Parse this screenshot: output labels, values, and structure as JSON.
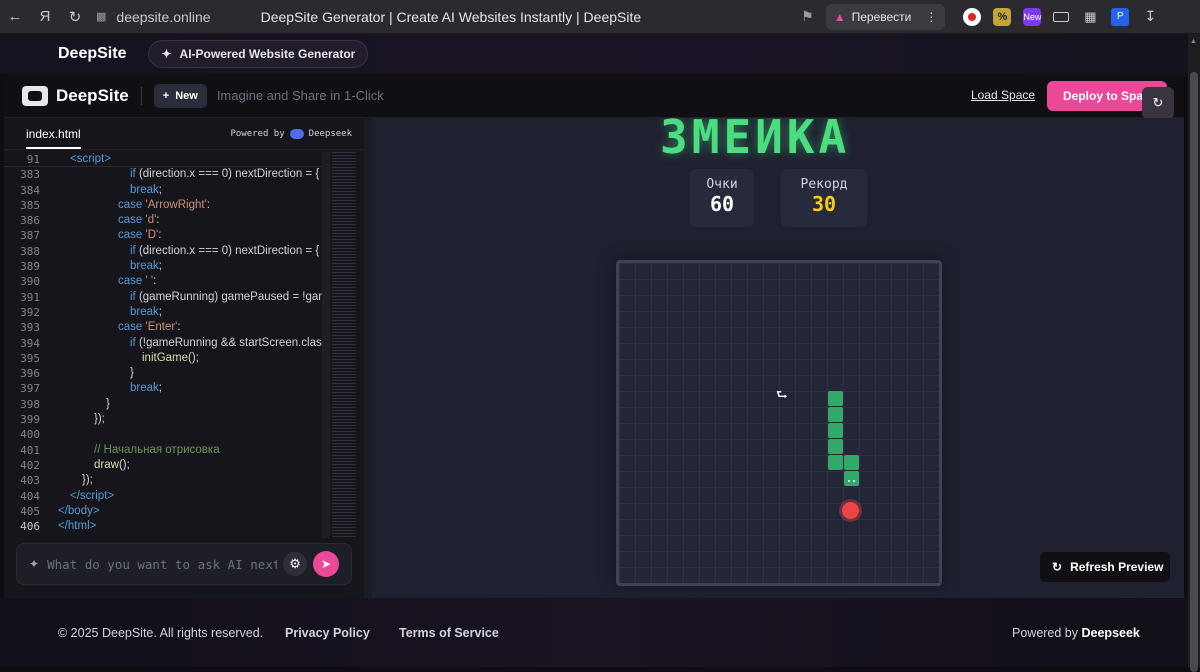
{
  "browser": {
    "url": "deepsite.online",
    "tab_title": "DeepSite Generator | Create AI Websites Instantly | DeepSite",
    "translate_label": "Перевести",
    "ext_new_badge": "New"
  },
  "top_strip": {
    "brand": "DeepSite",
    "pill_label": "AI-Powered Website Generator"
  },
  "header": {
    "logo_text": "DeepSite",
    "new_label": "New",
    "tagline": "Imagine and Share in 1-Click",
    "load_space": "Load Space",
    "deploy": "Deploy to Space"
  },
  "editor": {
    "file_tab": "index.html",
    "powered_prefix": "Powered by",
    "powered_brand": "Deepseek",
    "ask_placeholder": "What do you want to ask AI next?",
    "lines": [
      {
        "n": "91",
        "indent": 1,
        "html": "<span class=\"kw\">&lt;script&gt;</span>"
      },
      {
        "n": "383",
        "indent": 6,
        "html": "<span class=\"kw\">if</span> (direction.x === 0) nextDirection = {"
      },
      {
        "n": "384",
        "indent": 6,
        "html": "<span class=\"kw\">break</span>;"
      },
      {
        "n": "385",
        "indent": 5,
        "html": "<span class=\"kw\">case</span> <span class=\"str\">'ArrowRight'</span>:"
      },
      {
        "n": "386",
        "indent": 5,
        "html": "<span class=\"kw\">case</span> <span class=\"str\">'d'</span>:"
      },
      {
        "n": "387",
        "indent": 5,
        "html": "<span class=\"kw\">case</span> <span class=\"str\">'D'</span>:"
      },
      {
        "n": "388",
        "indent": 6,
        "html": "<span class=\"kw\">if</span> (direction.x === 0) nextDirection = {"
      },
      {
        "n": "389",
        "indent": 6,
        "html": "<span class=\"kw\">break</span>;"
      },
      {
        "n": "390",
        "indent": 5,
        "html": "<span class=\"kw\">case</span> <span class=\"str\">' '</span>:"
      },
      {
        "n": "391",
        "indent": 6,
        "html": "<span class=\"kw\">if</span> (gameRunning) gamePaused = !gar"
      },
      {
        "n": "392",
        "indent": 6,
        "html": "<span class=\"kw\">break</span>;"
      },
      {
        "n": "393",
        "indent": 5,
        "html": "<span class=\"kw\">case</span> <span class=\"str\">'Enter'</span>:"
      },
      {
        "n": "394",
        "indent": 6,
        "html": "<span class=\"kw\">if</span> (!gameRunning &amp;&amp; startScreen.clas"
      },
      {
        "n": "395",
        "indent": 7,
        "html": "<span class=\"fn\">initGame</span>();"
      },
      {
        "n": "396",
        "indent": 6,
        "html": "}"
      },
      {
        "n": "397",
        "indent": 6,
        "html": "<span class=\"kw\">break</span>;"
      },
      {
        "n": "398",
        "indent": 4,
        "html": "}"
      },
      {
        "n": "399",
        "indent": 3,
        "html": "});"
      },
      {
        "n": "400",
        "indent": 0,
        "html": ""
      },
      {
        "n": "401",
        "indent": 3,
        "html": "<span class=\"cmt\">// Начальная отрисовка</span>"
      },
      {
        "n": "402",
        "indent": 3,
        "html": "<span class=\"fn\">draw</span>();"
      },
      {
        "n": "403",
        "indent": 2,
        "html": "});"
      },
      {
        "n": "404",
        "indent": 1,
        "html": "<span class=\"kw\">&lt;/script&gt;</span>"
      },
      {
        "n": "405",
        "indent": 0,
        "html": "<span class=\"kw\">&lt;/body&gt;</span>"
      },
      {
        "n": "406",
        "indent": 0,
        "html": "<span class=\"kw\">&lt;/html&gt;</span>"
      }
    ]
  },
  "preview": {
    "game_title": "ЗМЕЙКА",
    "score_label": "Очки",
    "score_value": "60",
    "record_label": "Рекорд",
    "record_value": "30",
    "refresh_label": "Refresh Preview",
    "colors": {
      "title": "#4ade80",
      "score": "#ffffff",
      "record": "#facc15",
      "snake": "#34a86a",
      "food": "#ef4444"
    }
  },
  "footer": {
    "copyright": "© 2025 DeepSite. All rights reserved.",
    "privacy": "Privacy Policy",
    "terms": "Terms of Service",
    "powered_prefix": "Powered by",
    "powered_brand": "Deepseek"
  }
}
